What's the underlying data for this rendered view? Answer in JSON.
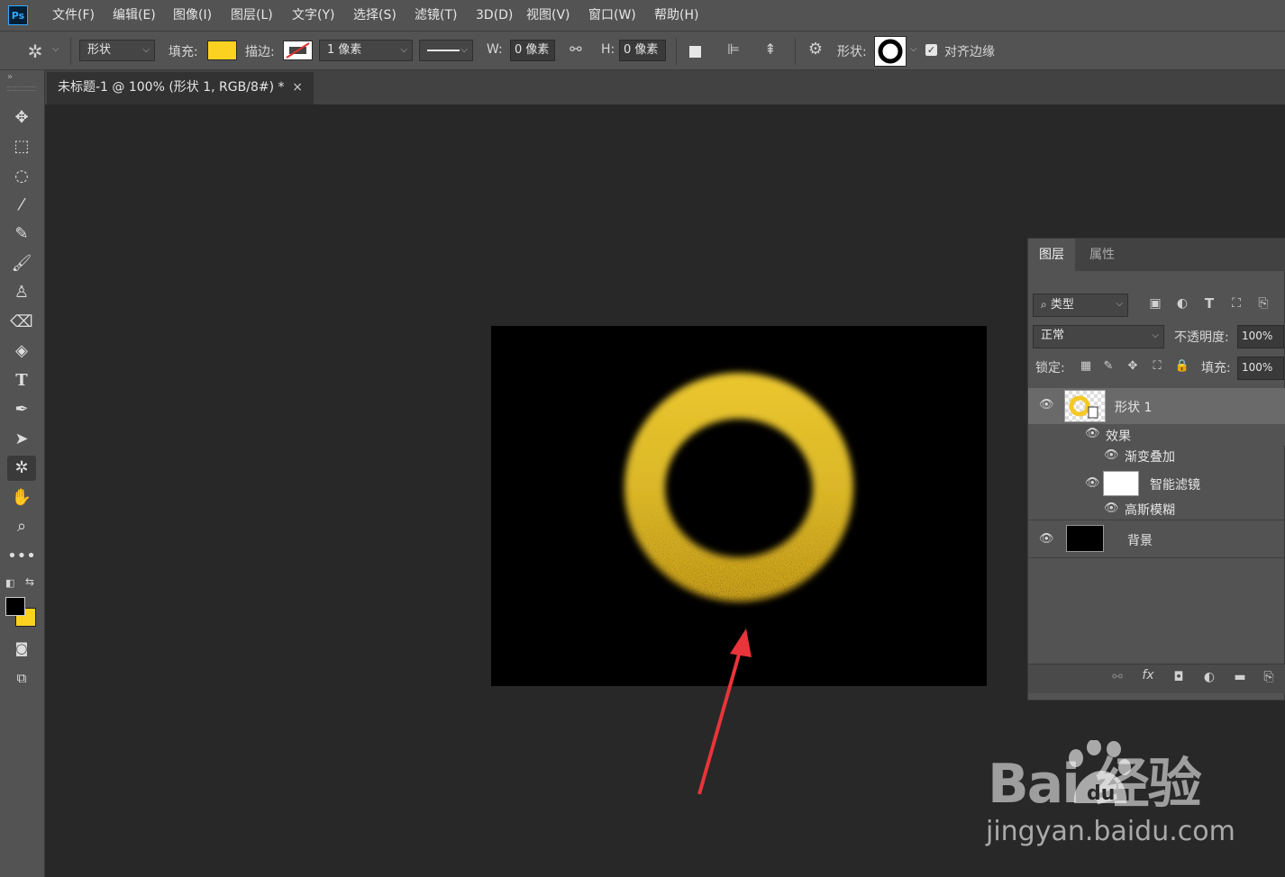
{
  "app": {
    "logo_text": "Ps"
  },
  "menu": [
    "文件(F)",
    "编辑(E)",
    "图像(I)",
    "图层(L)",
    "文字(Y)",
    "选择(S)",
    "滤镜(T)",
    "3D(D)",
    "视图(V)",
    "窗口(W)",
    "帮助(H)"
  ],
  "options": {
    "mode_value": "形状",
    "fill_label": "填充:",
    "fill_color": "#fcd220",
    "stroke_label": "描边:",
    "stroke_width_value": "1 像素",
    "w_label": "W:",
    "w_value": "0 像素",
    "h_label": "H:",
    "h_value": "0 像素",
    "shape_label": "形状:",
    "align_edges_label": "对齐边缘"
  },
  "document": {
    "tab_title": "未标题-1 @ 100% (形状 1, RGB/8#) *",
    "close_glyph": "×"
  },
  "colors": {
    "foreground": "#000000",
    "background": "#fcd220",
    "ring": "#f5c927",
    "arrow": "#e8343a"
  },
  "layers_panel": {
    "tabs": [
      "图层",
      "属性"
    ],
    "filter_value": "类型",
    "blend_mode": "正常",
    "opacity_label": "不透明度:",
    "opacity_value": "100%",
    "lock_label": "锁定:",
    "fill_label": "填充:",
    "fill_value": "100%",
    "layers": [
      {
        "name": "形状 1",
        "selected": true
      },
      {
        "name": "效果"
      },
      {
        "name": "渐变叠加"
      },
      {
        "name": "智能滤镜"
      },
      {
        "name": "高斯模糊"
      },
      {
        "name": "背景"
      }
    ]
  },
  "watermark": {
    "logo": "Bai  经验",
    "url": "jingyan.baidu.com"
  }
}
